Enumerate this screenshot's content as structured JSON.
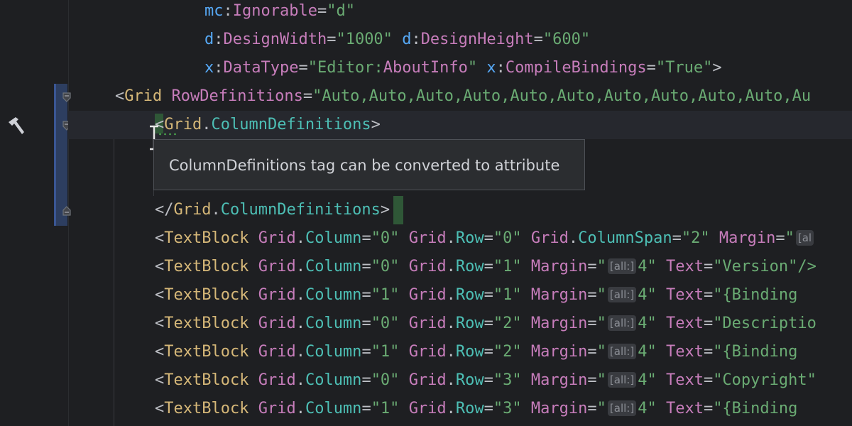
{
  "code": {
    "line1": {
      "prefix": "mc",
      "attr": "Ignorable",
      "value": "\"d\""
    },
    "line2": {
      "p1": "d",
      "a1": "DesignWidth",
      "v1": "\"1000\"",
      "p2": "d",
      "a2": "DesignHeight",
      "v2": "\"600\""
    },
    "line3": {
      "p1": "x",
      "a1": "DataType",
      "v1a": "\"",
      "v1b": "Editor",
      "v1c": ":",
      "v1d": "AboutInfo",
      "v1e": "\"",
      "p2": "x",
      "a2": "CompileBindings",
      "v2": "\"True\"",
      "end": ">"
    },
    "line4": {
      "tag": "Grid",
      "attr": "RowDefinitions",
      "value": "\"Auto,Auto,Auto,Auto,Auto,Auto,Auto,Auto,Auto,Auto,Au"
    },
    "line5": {
      "tag": "Grid",
      "prop": "ColumnDefinitions"
    },
    "line7": {
      "tag": "Grid",
      "prop": "ColumnDefinitions"
    },
    "rows": [
      {
        "c1": "Column",
        "v1": "\"0\"",
        "c2": "Row",
        "v2": "\"0\"",
        "rest_attr": "Grid",
        "rest_prop": "ColumnSpan",
        "rest_val": "\"2\"",
        "m": "Margin",
        "tail_hint": "[al"
      },
      {
        "c1": "Column",
        "v1": "\"0\"",
        "c2": "Row",
        "v2": "\"1\"",
        "m": "Margin",
        "hint": "[all:]",
        "mv": "4\"",
        "t": "Text",
        "tv": "\"Version\"/>"
      },
      {
        "c1": "Column",
        "v1": "\"1\"",
        "c2": "Row",
        "v2": "\"1\"",
        "m": "Margin",
        "hint": "[all:]",
        "mv": "4\"",
        "t": "Text",
        "tv": "\"{Binding "
      },
      {
        "c1": "Column",
        "v1": "\"0\"",
        "c2": "Row",
        "v2": "\"2\"",
        "m": "Margin",
        "hint": "[all:]",
        "mv": "4\"",
        "t": "Text",
        "tv": "\"Descriptio"
      },
      {
        "c1": "Column",
        "v1": "\"1\"",
        "c2": "Row",
        "v2": "\"2\"",
        "m": "Margin",
        "hint": "[all:]",
        "mv": "4\"",
        "t": "Text",
        "tv": "\"{Binding "
      },
      {
        "c1": "Column",
        "v1": "\"0\"",
        "c2": "Row",
        "v2": "\"3\"",
        "m": "Margin",
        "hint": "[all:]",
        "mv": "4\"",
        "t": "Text",
        "tv": "\"Copyright\""
      },
      {
        "c1": "Column",
        "v1": "\"1\"",
        "c2": "Row",
        "v2": "\"3\"",
        "m": "Margin",
        "hint": "[all:]",
        "mv": "4\"",
        "t": "Text",
        "tv": "\"{Binding "
      }
    ],
    "textblock": "TextBlock",
    "grid": "Grid"
  },
  "tooltip": {
    "text": "ColumnDefinitions tag can be converted to attribute"
  },
  "icons": {
    "gutter_action": "hammer-icon",
    "fold": "fold-marker-icon"
  },
  "colors": {
    "background": "#1e1f22",
    "tag": "#d5b778",
    "attr": "#c77dbb",
    "string": "#6aab73",
    "prefix": "#56a8f5"
  }
}
